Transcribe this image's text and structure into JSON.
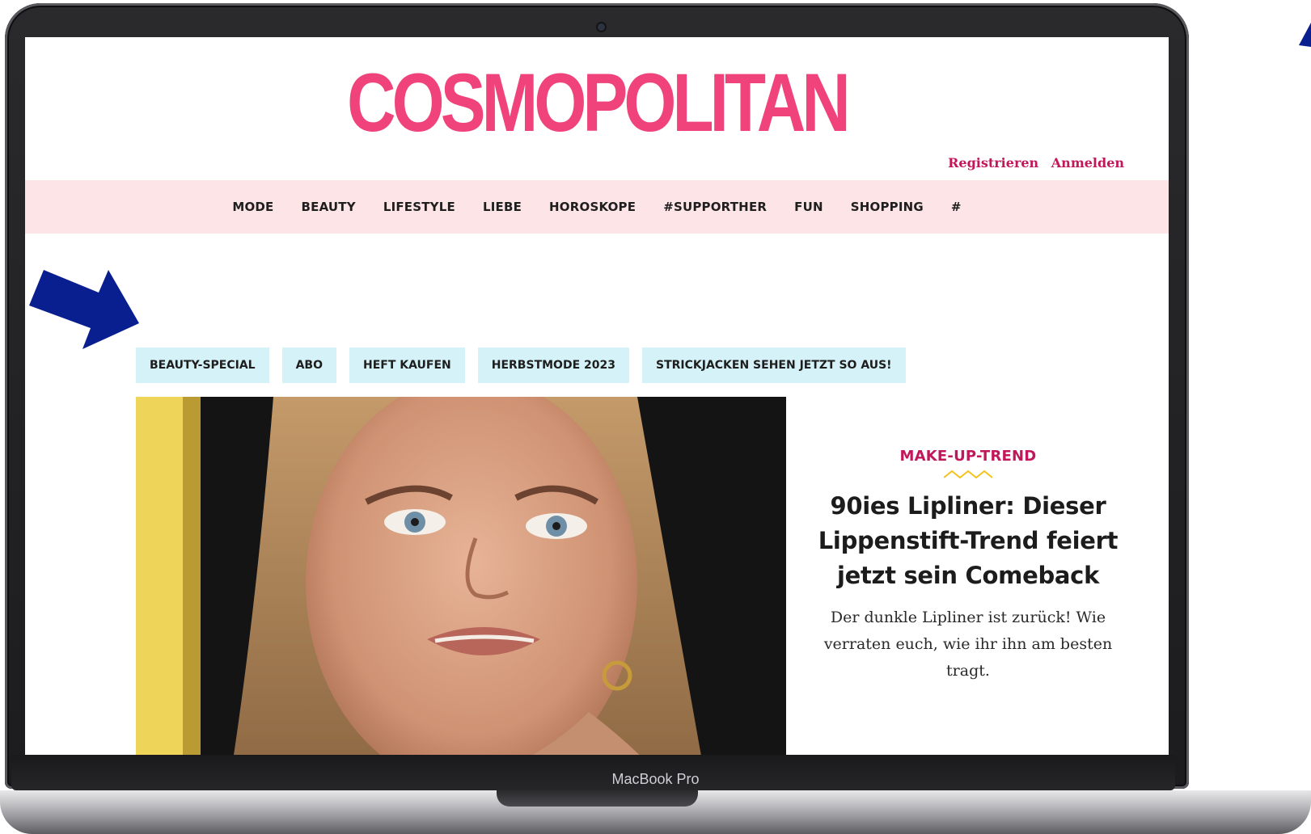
{
  "device": {
    "model_label": "MacBook Pro"
  },
  "site": {
    "logo_text": "COSMOPOLITAN",
    "brand_color": "#f0437c",
    "accent_color": "#c2175b"
  },
  "account": {
    "register_label": "Registrieren",
    "login_label": "Anmelden"
  },
  "nav": {
    "background": "#fde4e6",
    "items": [
      {
        "label": "MODE"
      },
      {
        "label": "BEAUTY"
      },
      {
        "label": "LIFESTYLE"
      },
      {
        "label": "LIEBE"
      },
      {
        "label": "HOROSKOPE"
      },
      {
        "label": "#SUPPORTHER"
      },
      {
        "label": "FUN"
      },
      {
        "label": "SHOPPING"
      },
      {
        "label": "#"
      }
    ]
  },
  "tags": {
    "background": "#d4f2f7",
    "items": [
      {
        "label": "BEAUTY-SPECIAL"
      },
      {
        "label": "ABO"
      },
      {
        "label": "HEFT KAUFEN"
      },
      {
        "label": "HERBSTMODE 2023"
      },
      {
        "label": "STRICKJACKEN SEHEN JETZT SO AUS!"
      }
    ]
  },
  "teaser": {
    "kicker": "MAKE-UP-TREND",
    "headline": "90ies Lipliner: Dieser Lippenstift-Trend feiert jetzt sein Comeback",
    "summary": "Der dunkle Lipliner ist zurück! Wie verraten euch, wie ihr ihn am besten tragt.",
    "zigzag_color": "#f4c21b"
  },
  "annotation": {
    "arrow_color": "#0a1f8f",
    "arrow_icon": "arrow-right-down-icon"
  }
}
